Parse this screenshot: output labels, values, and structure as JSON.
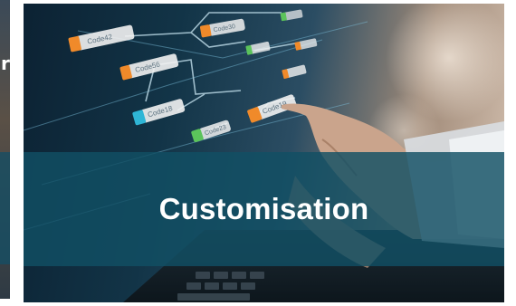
{
  "card": {
    "title": "Customisation",
    "overlay_color": "#114f64"
  },
  "image": {
    "node_labels": [
      "Code42",
      "Code56",
      "Code18",
      "Code23",
      "Code19",
      "Code30"
    ]
  }
}
